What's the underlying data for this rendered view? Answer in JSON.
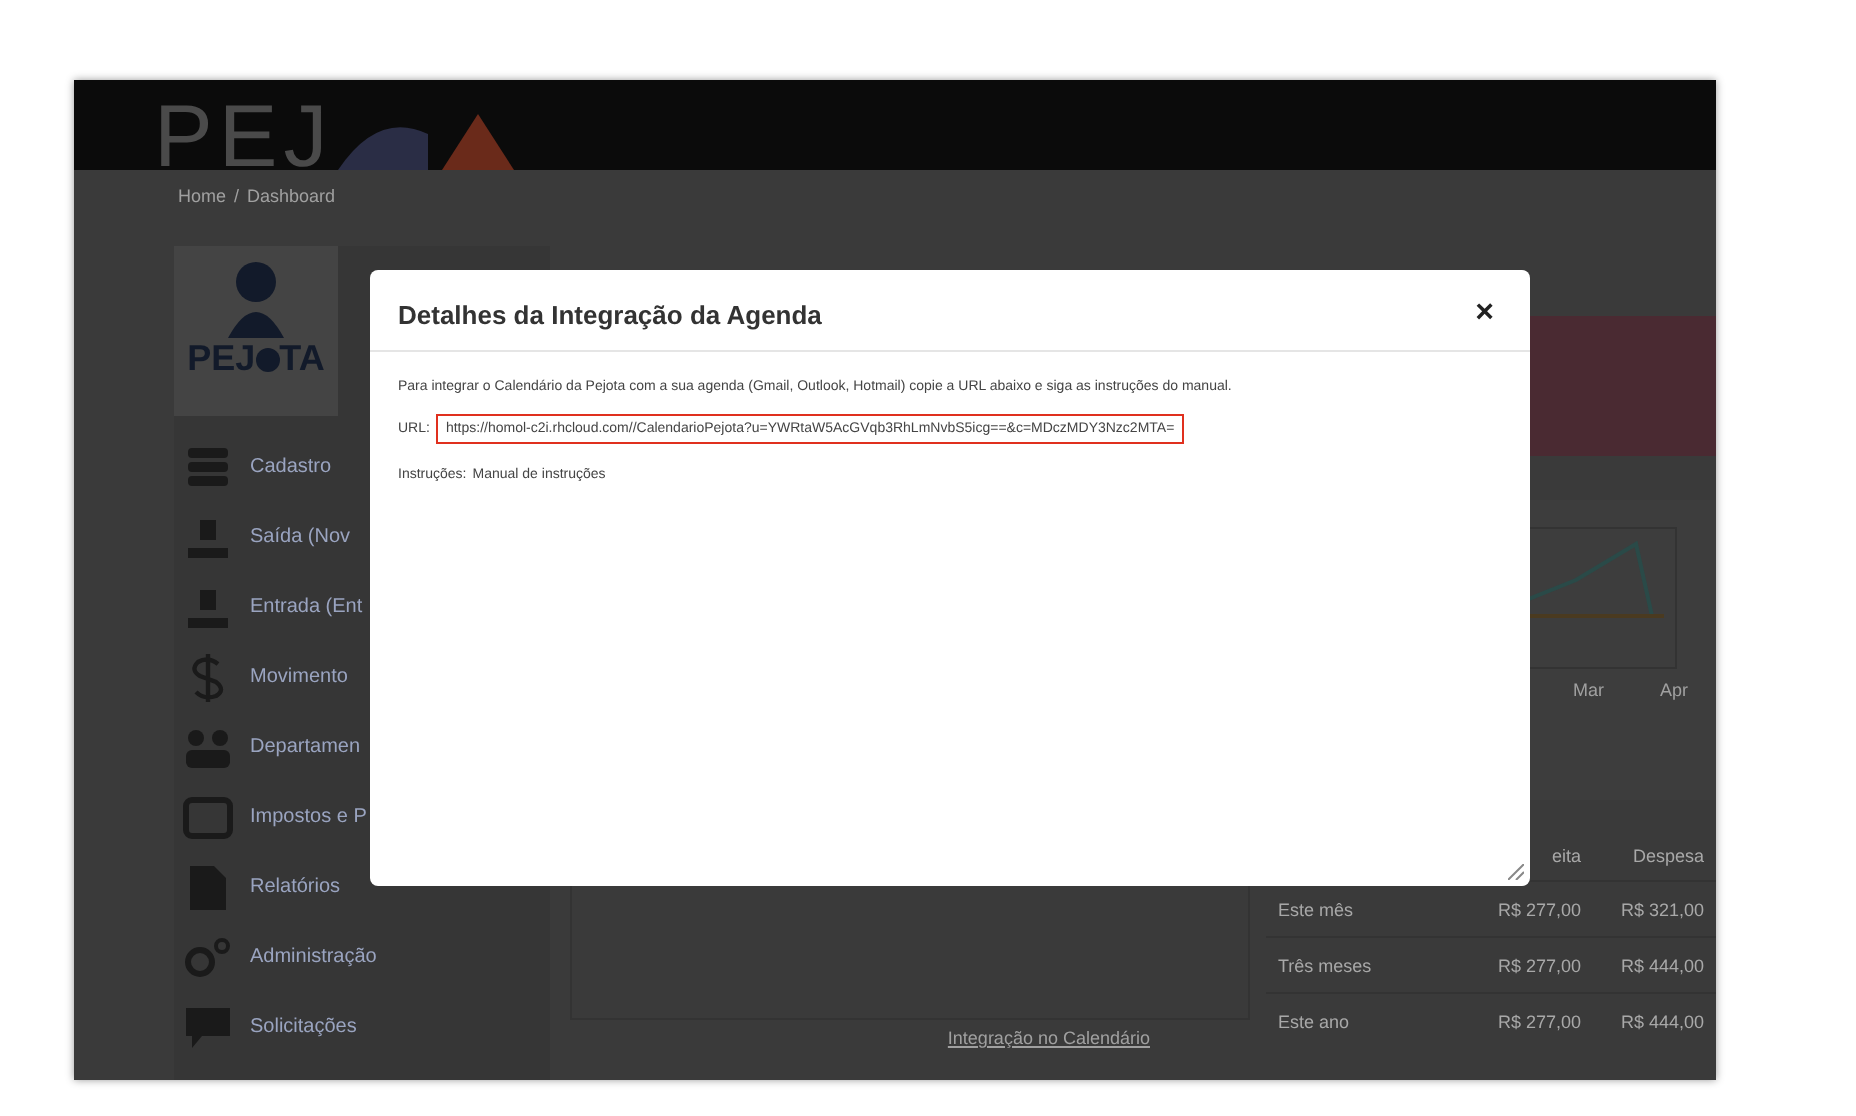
{
  "header": {
    "logo_text": "PEJ"
  },
  "breadcrumb": [
    "Home",
    "Dashboard"
  ],
  "breadcrumb_separator": "/",
  "sidebar": {
    "logo_left": "PEJ",
    "logo_right": "TA",
    "items": [
      {
        "label": "Cadastro",
        "kind": "stack"
      },
      {
        "label": "Saída (Nov",
        "kind": "out"
      },
      {
        "label": "Entrada (Ent",
        "kind": "in"
      },
      {
        "label": "Movimento",
        "kind": "dollar"
      },
      {
        "label": "Departamen",
        "kind": "people"
      },
      {
        "label": "Impostos e P",
        "kind": "tray"
      },
      {
        "label": "Relatórios",
        "kind": "report"
      },
      {
        "label": "Administração",
        "kind": "gears"
      },
      {
        "label": "Solicitações",
        "kind": "chat"
      }
    ]
  },
  "chart_labels": [
    "Mar",
    "Apr"
  ],
  "summary_table": {
    "columns": [
      "",
      "eita",
      "Despesa"
    ],
    "rows": [
      [
        "Este mês",
        "R$ 277,00",
        "R$ 321,00"
      ],
      [
        "Três meses",
        "R$ 277,00",
        "R$ 444,00"
      ],
      [
        "Este ano",
        "R$ 277,00",
        "R$ 444,00"
      ]
    ]
  },
  "calendar_link": "Integração no Calendário",
  "modal": {
    "title": "Detalhes da Integração da Agenda",
    "close": "×",
    "intro": "Para integrar o Calendário da Pejota com a sua agenda (Gmail, Outlook, Hotmail) copie a URL abaixo e siga as instruções do manual.",
    "url_label": "URL:",
    "url": "https://homol-c2i.rhcloud.com//CalendarioPejota?u=YWRtaW5AcGVqb3RhLmNvbS5icg==&c=MDczMDY3Nzc2MTA=",
    "instructions_label": "Instruções:",
    "instructions_link": "Manual de instruções"
  }
}
